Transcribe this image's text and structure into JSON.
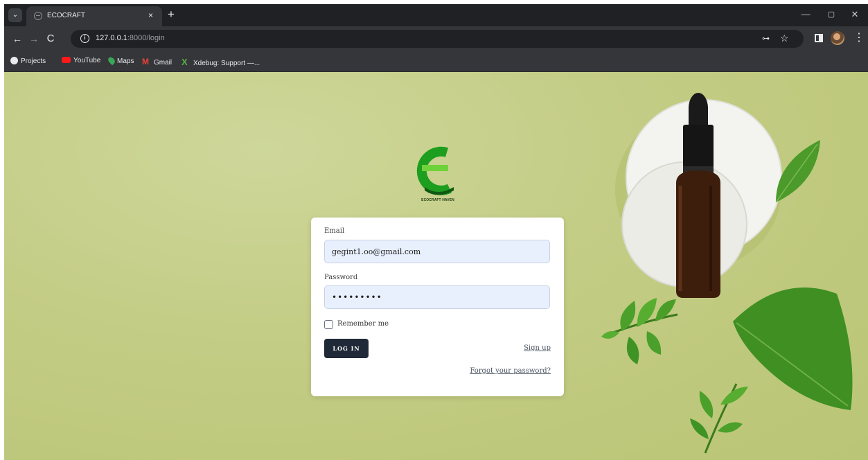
{
  "browser": {
    "tab": {
      "title": "ECOCRAFT",
      "favicon": "globe-icon"
    },
    "toolbar": {
      "url_host": "127.0.0.1",
      "url_path": ":8000/login"
    },
    "bookmarks": [
      {
        "label": "Projects",
        "icon": "chrome-icon"
      },
      {
        "label": "YouTube",
        "icon": "youtube-icon"
      },
      {
        "label": "Maps",
        "icon": "maps-icon"
      },
      {
        "label": "Gmail",
        "icon": "gmail-icon"
      },
      {
        "label": "Xdebug: Support —...",
        "icon": "xdebug-icon"
      }
    ],
    "icons": {
      "back": "←",
      "forward": "→",
      "reload": "C",
      "close": "×",
      "new_tab": "+",
      "minimize": "—",
      "restore": "▢",
      "window_close": "✕",
      "star": "☆",
      "key": "⊶",
      "menu": "⋮",
      "tab_menu": "⌄",
      "info": "i",
      "gmail": "M",
      "xdebug": "X"
    }
  },
  "page": {
    "logo_caption": "ECOCRAFT HAVEN",
    "login": {
      "email_label": "Email",
      "email_value": "gegint1.oo@gmail.com",
      "password_label": "Password",
      "password_value": "•••••••••",
      "remember_label": "Remember me",
      "login_button": "LOG IN",
      "signup_link": "Sign up",
      "forgot_link": "Forgot your password?"
    }
  },
  "colors": {
    "page_background": "#c4cc80",
    "button": "#1f2937",
    "logo_green": "#1e9e1e",
    "input_fill": "#e8f0fe"
  }
}
